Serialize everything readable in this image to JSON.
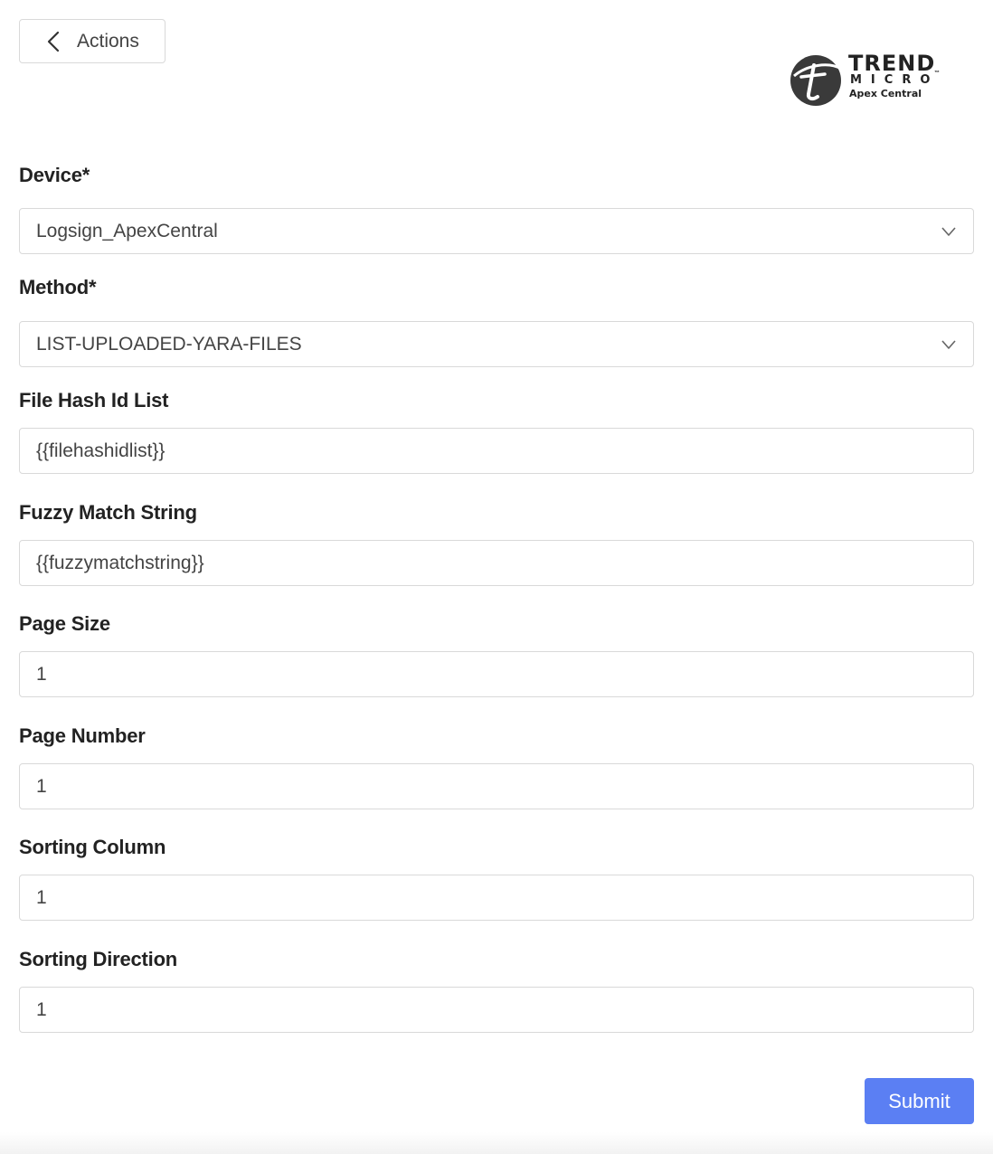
{
  "header": {
    "back_label": "Actions"
  },
  "logo": {
    "line1": "TREND",
    "line2": "MICRO",
    "tm": "™",
    "product": "Apex Central"
  },
  "form": {
    "device": {
      "label": "Device*",
      "value": "Logsign_ApexCentral"
    },
    "method": {
      "label": "Method*",
      "value": "LIST-UPLOADED-YARA-FILES"
    },
    "file_hash_id_list": {
      "label": "File Hash Id List",
      "value": "{{filehashidlist}}"
    },
    "fuzzy_match_string": {
      "label": "Fuzzy Match String",
      "value": "{{fuzzymatchstring}}"
    },
    "page_size": {
      "label": "Page Size",
      "value": "1"
    },
    "page_number": {
      "label": "Page Number",
      "value": "1"
    },
    "sorting_column": {
      "label": "Sorting Column",
      "value": "1"
    },
    "sorting_direction": {
      "label": "Sorting Direction",
      "value": "1"
    }
  },
  "submit_label": "Submit",
  "colors": {
    "accent": "#5b7ff3",
    "border": "#d9d9d9",
    "text": "#222222"
  }
}
